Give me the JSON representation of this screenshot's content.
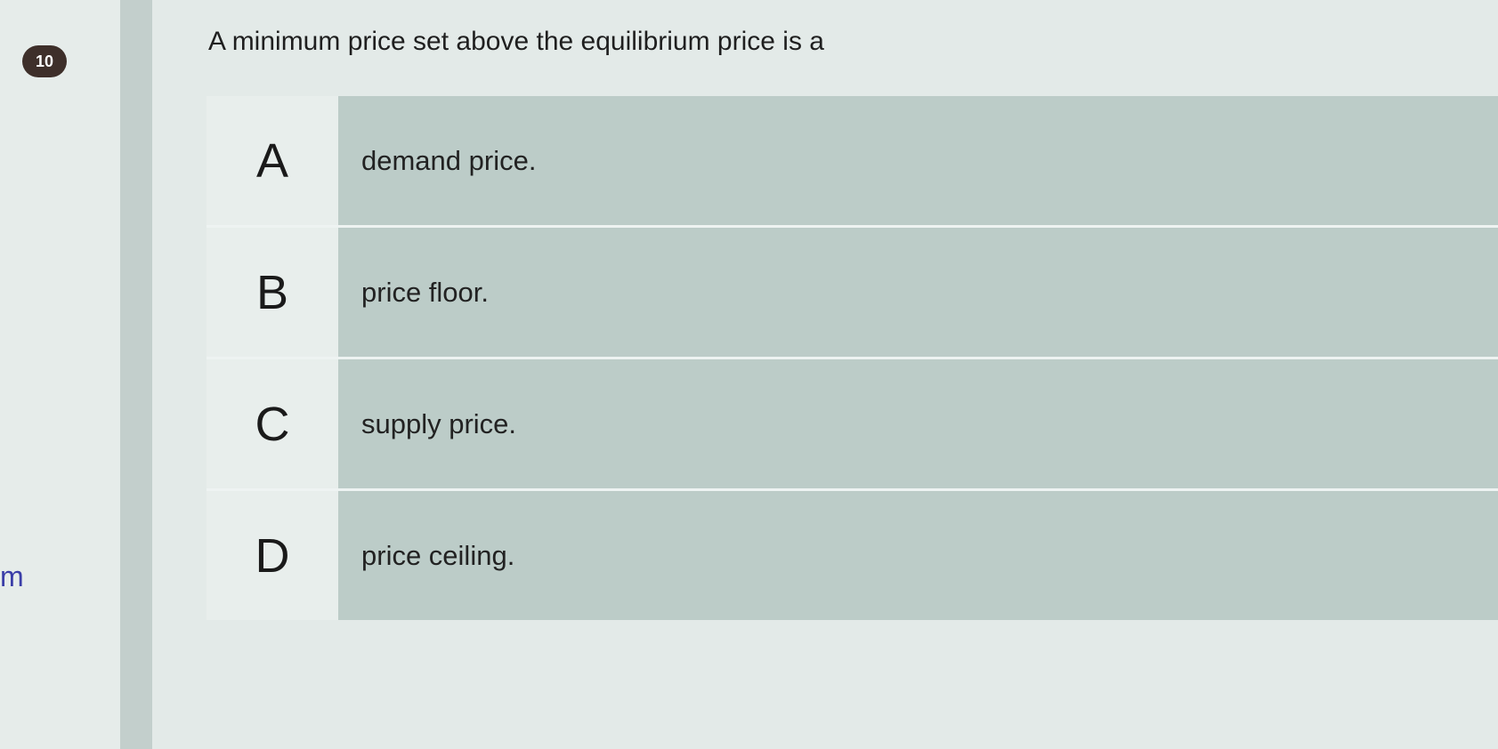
{
  "question": {
    "number": "10",
    "text": "A minimum price set above the equilibrium price is a"
  },
  "options": [
    {
      "letter": "A",
      "text": "demand price."
    },
    {
      "letter": "B",
      "text": "price floor."
    },
    {
      "letter": "C",
      "text": "supply price."
    },
    {
      "letter": "D",
      "text": "price ceiling."
    }
  ],
  "sidebar": {
    "partial_text": "m"
  }
}
